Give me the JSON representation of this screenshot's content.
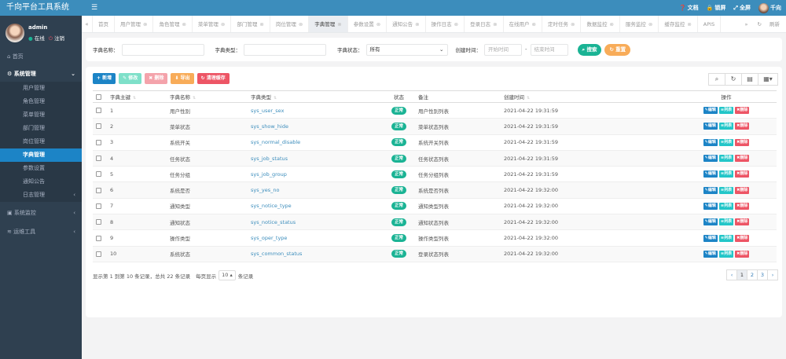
{
  "header": {
    "brand": "千向平台工具系统",
    "menu_icon": "☰",
    "right": [
      {
        "icon": "question-icon",
        "label": "文档"
      },
      {
        "icon": "lock-icon",
        "label": "锁屏"
      },
      {
        "icon": "fullscreen-icon",
        "label": "全屏"
      }
    ],
    "user": "千向"
  },
  "sidebar": {
    "user": {
      "name": "admin",
      "online": "在线",
      "logout": "注销"
    },
    "home": "首页",
    "groups": [
      {
        "label": "系统管理",
        "expanded": true,
        "items": [
          {
            "label": "用户管理"
          },
          {
            "label": "角色管理"
          },
          {
            "label": "菜单管理"
          },
          {
            "label": "部门管理"
          },
          {
            "label": "岗位管理"
          },
          {
            "label": "字典管理",
            "active": true
          },
          {
            "label": "参数设置"
          },
          {
            "label": "通知公告"
          },
          {
            "label": "日志管理",
            "arrow": "‹"
          }
        ]
      },
      {
        "label": "系统监控",
        "expanded": false
      },
      {
        "label": "运维工具",
        "expanded": false
      }
    ]
  },
  "tabs": {
    "items": [
      "首页",
      "用户管理",
      "角色管理",
      "菜单管理",
      "部门管理",
      "岗位管理",
      "字典管理",
      "参数设置",
      "通知公告",
      "操作日志",
      "登录日志",
      "在线用户",
      "定时任务",
      "数据监控",
      "服务监控",
      "缓存监控",
      "APIS"
    ],
    "active": "字典管理",
    "refresh": "刷新"
  },
  "search": {
    "dict_name_label": "字典名称：",
    "dict_type_label": "字典类型：",
    "status_label": "字典状态：",
    "status_value": "所有",
    "created_label": "创建时间：",
    "start_placeholder": "开始时间",
    "end_placeholder": "结束时间",
    "search_button": "搜索",
    "reset_button": "重置"
  },
  "toolbar": {
    "add": "新增",
    "edit": "修改",
    "delete": "删除",
    "export": "导出",
    "clear_cache": "清理缓存"
  },
  "table": {
    "columns": [
      "字典主键",
      "字典名称",
      "字典类型",
      "状态",
      "备注",
      "创建时间",
      "操作"
    ],
    "rows": [
      {
        "id": "1",
        "name": "用户性别",
        "type": "sys_user_sex",
        "status": "正常",
        "remark": "用户性别列表",
        "created": "2021-04-22 19:31:59"
      },
      {
        "id": "2",
        "name": "菜单状态",
        "type": "sys_show_hide",
        "status": "正常",
        "remark": "菜单状态列表",
        "created": "2021-04-22 19:31:59"
      },
      {
        "id": "3",
        "name": "系统开关",
        "type": "sys_normal_disable",
        "status": "正常",
        "remark": "系统开关列表",
        "created": "2021-04-22 19:31:59"
      },
      {
        "id": "4",
        "name": "任务状态",
        "type": "sys_job_status",
        "status": "正常",
        "remark": "任务状态列表",
        "created": "2021-04-22 19:31:59"
      },
      {
        "id": "5",
        "name": "任务分组",
        "type": "sys_job_group",
        "status": "正常",
        "remark": "任务分组列表",
        "created": "2021-04-22 19:31:59"
      },
      {
        "id": "6",
        "name": "系统是否",
        "type": "sys_yes_no",
        "status": "正常",
        "remark": "系统是否列表",
        "created": "2021-04-22 19:32:00"
      },
      {
        "id": "7",
        "name": "通知类型",
        "type": "sys_notice_type",
        "status": "正常",
        "remark": "通知类型列表",
        "created": "2021-04-22 19:32:00"
      },
      {
        "id": "8",
        "name": "通知状态",
        "type": "sys_notice_status",
        "status": "正常",
        "remark": "通知状态列表",
        "created": "2021-04-22 19:32:00"
      },
      {
        "id": "9",
        "name": "操作类型",
        "type": "sys_oper_type",
        "status": "正常",
        "remark": "操作类型列表",
        "created": "2021-04-22 19:32:00"
      },
      {
        "id": "10",
        "name": "系统状态",
        "type": "sys_common_status",
        "status": "正常",
        "remark": "登录状态列表",
        "created": "2021-04-22 19:32:00"
      }
    ],
    "actions": {
      "edit": "编辑",
      "list": "列表",
      "delete": "删除"
    }
  },
  "pagination": {
    "summary": "显示第 1 到第 10 条记录，总共 22 条记录",
    "per_page_label": "每页显示",
    "per_page": "10",
    "per_page_suffix": "条记录",
    "pages": [
      "‹",
      "1",
      "2",
      "3",
      "›"
    ],
    "current": "1"
  },
  "colors": {
    "header": "#3c8dbc",
    "sidebar": "#2f4050",
    "active_item": "#1c84c6",
    "success": "#1ab394",
    "info": "#23c6c8",
    "danger": "#ed5565",
    "warning": "#f8ac59"
  }
}
